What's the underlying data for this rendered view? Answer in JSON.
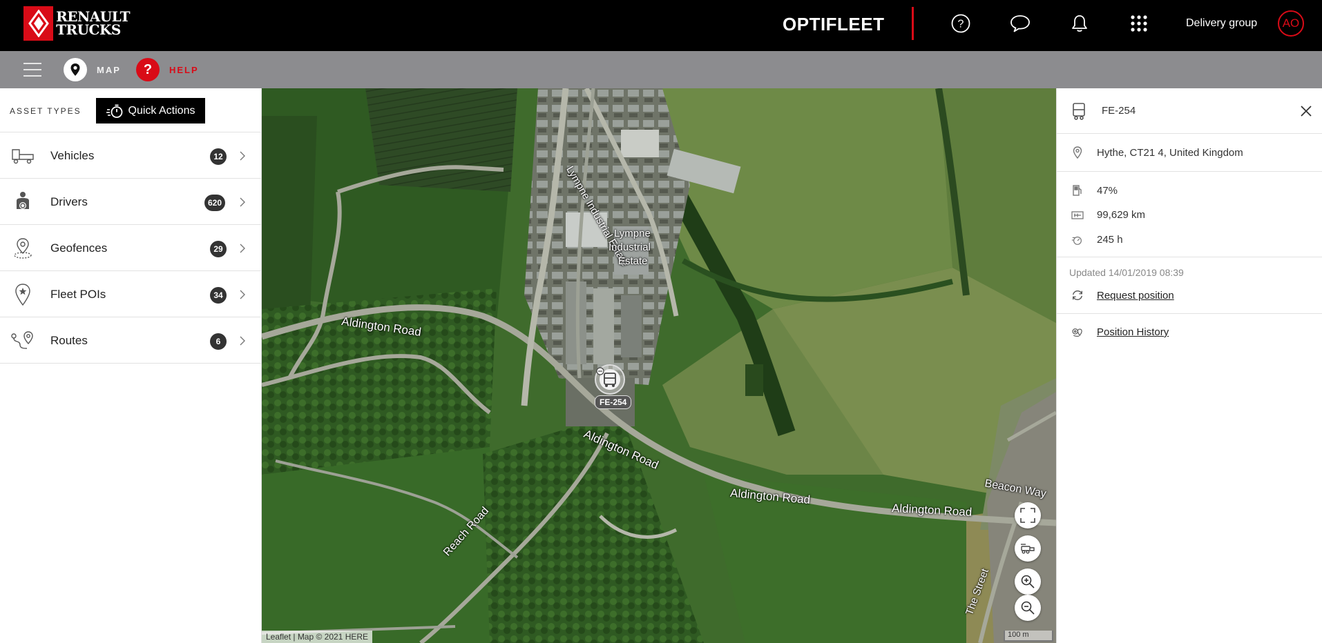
{
  "header": {
    "logo_line1": "RENAULT",
    "logo_line2": "TRUCKS",
    "app_title": "OPTIFLEET",
    "group_label": "Delivery group",
    "avatar_initials": "AO",
    "accent_color": "#d90b17"
  },
  "subnav": {
    "map_label": "MAP",
    "help_label": "HELP"
  },
  "asset_panel": {
    "title": "ASSET TYPES",
    "quick_actions_label": "Quick Actions",
    "items": [
      {
        "label": "Vehicles",
        "count": "12",
        "icon": "truck-icon"
      },
      {
        "label": "Drivers",
        "count": "620",
        "icon": "driver-icon"
      },
      {
        "label": "Geofences",
        "count": "29",
        "icon": "geofence-icon"
      },
      {
        "label": "Fleet POIs",
        "count": "34",
        "icon": "poi-icon"
      },
      {
        "label": "Routes",
        "count": "6",
        "icon": "route-icon"
      }
    ]
  },
  "map": {
    "labels": {
      "lympne_industrial_estate_road": "Lympne Industrial Estate",
      "estate_l1": "Lympne",
      "estate_l2": "Industrial",
      "estate_l3": "Estate",
      "aldington_1": "Aldington  Road",
      "aldington_2": "Aldington Road",
      "aldington_3": "Aldington Road",
      "aldington_4": "Aldington Road",
      "reach_road": "Reach Road",
      "beacon_way": "Beacon Way",
      "the_street": "The Street"
    },
    "vehicle_tag": "FE-254",
    "attribution": "Leaflet | Map © 2021 HERE",
    "scale": "100 m"
  },
  "detail_panel": {
    "vehicle_id": "FE-254",
    "location": "Hythe, CT21 4, United Kingdom",
    "fuel": "47%",
    "odometer": "99,629 km",
    "engine_hours": "245 h",
    "updated": "Updated 14/01/2019 08:39",
    "request_position": "Request position",
    "position_history": "Position History"
  }
}
